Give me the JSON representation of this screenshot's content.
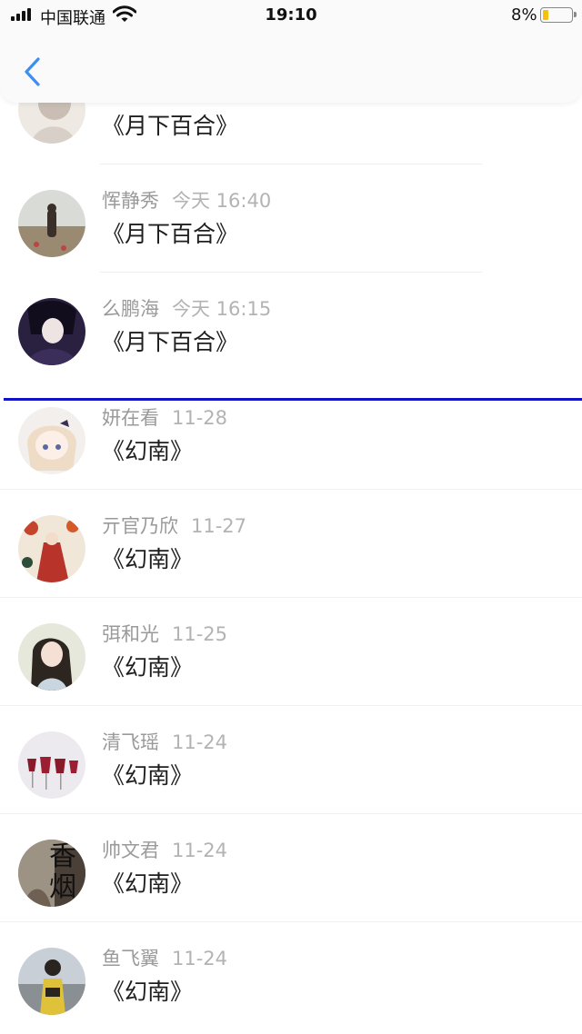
{
  "status_bar": {
    "carrier": "中国联通",
    "time": "19:10",
    "battery_percent": "8%",
    "battery_level": 0.08,
    "battery_color": "#f4c20d"
  },
  "header": {
    "back_icon": "chevron-left-icon",
    "accent_color": "#3d8ff0"
  },
  "divider_color": "#1212c8",
  "rows": [
    {
      "name": "",
      "time": "",
      "title": "《月下百合》",
      "avatar": "avatar-image"
    },
    {
      "name": "恽静秀",
      "time": "今天 16:40",
      "title": "《月下百合》",
      "avatar": "avatar-image"
    },
    {
      "name": "么鹏海",
      "time": "今天 16:15",
      "title": "《月下百合》",
      "avatar": "avatar-image"
    },
    {
      "name": "妍在看",
      "time": "11-28",
      "title": "《幻南》",
      "avatar": "avatar-image"
    },
    {
      "name": "亓官乃欣",
      "time": "11-27",
      "title": "《幻南》",
      "avatar": "avatar-image"
    },
    {
      "name": "弭和光",
      "time": "11-25",
      "title": "《幻南》",
      "avatar": "avatar-image"
    },
    {
      "name": "清飞瑶",
      "time": "11-24",
      "title": "《幻南》",
      "avatar": "avatar-image"
    },
    {
      "name": "帅文君",
      "time": "11-24",
      "title": "《幻南》",
      "avatar": "avatar-image",
      "avatar_text": "香烟"
    },
    {
      "name": "鱼飞翼",
      "time": "11-24",
      "title": "《幻南》",
      "avatar": "avatar-image"
    }
  ]
}
